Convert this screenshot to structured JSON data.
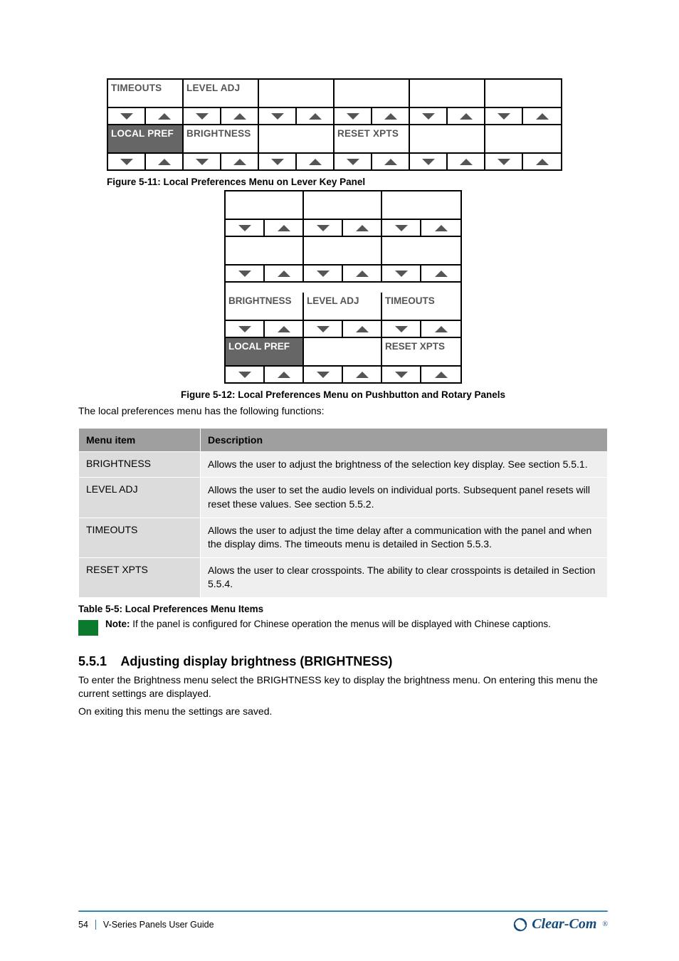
{
  "fig1": {
    "row1": [
      "TIMEOUTS",
      "LEVEL ADJ",
      "",
      "",
      "",
      ""
    ],
    "row1_selected": [
      false,
      false,
      false,
      false,
      false,
      false
    ],
    "row2": [
      "LOCAL PREF",
      "BRIGHTNESS",
      "",
      "RESET XPTS",
      "",
      ""
    ],
    "row2_selected": [
      true,
      false,
      false,
      false,
      false,
      false
    ],
    "caption": "Figure 5-11: Local Preferences Menu on Lever Key Panel"
  },
  "fig2": {
    "groups": [
      {
        "labels": [
          "",
          "",
          ""
        ],
        "selected": [
          false,
          false,
          false
        ]
      },
      {
        "labels": [
          "",
          "",
          ""
        ],
        "selected": [
          false,
          false,
          false
        ]
      },
      {
        "labels": [
          "BRIGHTNESS",
          "LEVEL ADJ",
          "TIMEOUTS"
        ],
        "selected": [
          false,
          false,
          false
        ]
      },
      {
        "labels": [
          "LOCAL PREF",
          "",
          "RESET XPTS"
        ],
        "selected": [
          true,
          false,
          false
        ]
      }
    ],
    "caption": "Figure 5-12: Local Preferences Menu on Pushbutton and Rotary Panels"
  },
  "intro": "The local preferences menu has the following functions:",
  "tableHeader": {
    "menu": "Menu item",
    "desc": "Description"
  },
  "tableRows": [
    {
      "menu": "BRIGHTNESS",
      "desc": "Allows the user to adjust the brightness of the selection key display. See section 5.5.1."
    },
    {
      "menu": "LEVEL ADJ",
      "desc": "Allows the user to set the audio levels on individual ports. Subsequent panel resets will reset these values. See section 5.5.2."
    },
    {
      "menu": "TIMEOUTS",
      "desc": "Allows the user to adjust the time delay after a communication with the panel and when the display dims. The timeouts menu is detailed in Section 5.5.3."
    },
    {
      "menu": "RESET XPTS",
      "desc": "Alows the user to clear crosspoints. The ability to clear crosspoints is detailed in Section 5.5.4."
    }
  ],
  "tableCaption": "Table 5-5: Local Preferences Menu Items",
  "note": {
    "head": "Note:",
    "body": "If the panel is configured for Chinese operation the menus will be displayed with Chinese captions."
  },
  "section": {
    "num": "5.5.1",
    "title": "Adjusting display brightness (BRIGHTNESS)",
    "p1": "To enter the Brightness menu select the BRIGHTNESS key to display the brightness menu. On entering this menu the current settings are displayed.",
    "p2": "On exiting this menu the settings are saved."
  },
  "footer": {
    "page": "54",
    "title": "V-Series Panels User Guide",
    "brand": "Clear-Com"
  }
}
